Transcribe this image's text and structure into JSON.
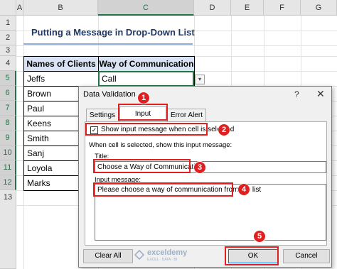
{
  "sheet": {
    "columns": [
      "A",
      "B",
      "C",
      "D",
      "E",
      "F",
      "G"
    ],
    "selected_column": "C",
    "rows": [
      "1",
      "2",
      "3",
      "4",
      "5",
      "6",
      "7",
      "8",
      "9",
      "10",
      "11",
      "12",
      "13"
    ],
    "selected_rows": [
      "5",
      "6",
      "7",
      "8",
      "9",
      "10",
      "11",
      "12"
    ],
    "title": "Putting a Message in Drop-Down List",
    "headers": [
      "Names of Clients",
      "Way of Communication"
    ],
    "clients": [
      "Jeffs",
      "Brown",
      "Paul",
      "Keens",
      "Smith",
      "Sanj",
      "Loyola",
      "Marks"
    ],
    "first_value": "Call",
    "dropdown_arrow": "▾"
  },
  "dialog": {
    "title": "Data Validation",
    "help_glyph": "?",
    "close_glyph": "✕",
    "tabs": [
      "Settings",
      "Input Message",
      "Error Alert"
    ],
    "active_tab": "Input Message",
    "checkbox_label": "Show input message when cell is selected",
    "checkbox_checked": true,
    "checkbox_glyph": "✓",
    "hint": "When cell is selected, show this input message:",
    "title_label": "Title:",
    "title_value": "Choose a Way of Communication",
    "message_label": "Input message:",
    "message_value": "Please choose a way of communication from the list",
    "clear_all_label": "Clear All",
    "ok_label": "OK",
    "cancel_label": "Cancel"
  },
  "annotations": {
    "badges": [
      "1",
      "2",
      "3",
      "4",
      "5"
    ],
    "color": "#e02020"
  },
  "watermark": {
    "brand": "exceldemy",
    "tagline": "EXCEL · DATA · BI"
  },
  "colors": {
    "excel_green": "#217346",
    "header_fill": "#dae3f3",
    "title_color": "#1f3864"
  }
}
